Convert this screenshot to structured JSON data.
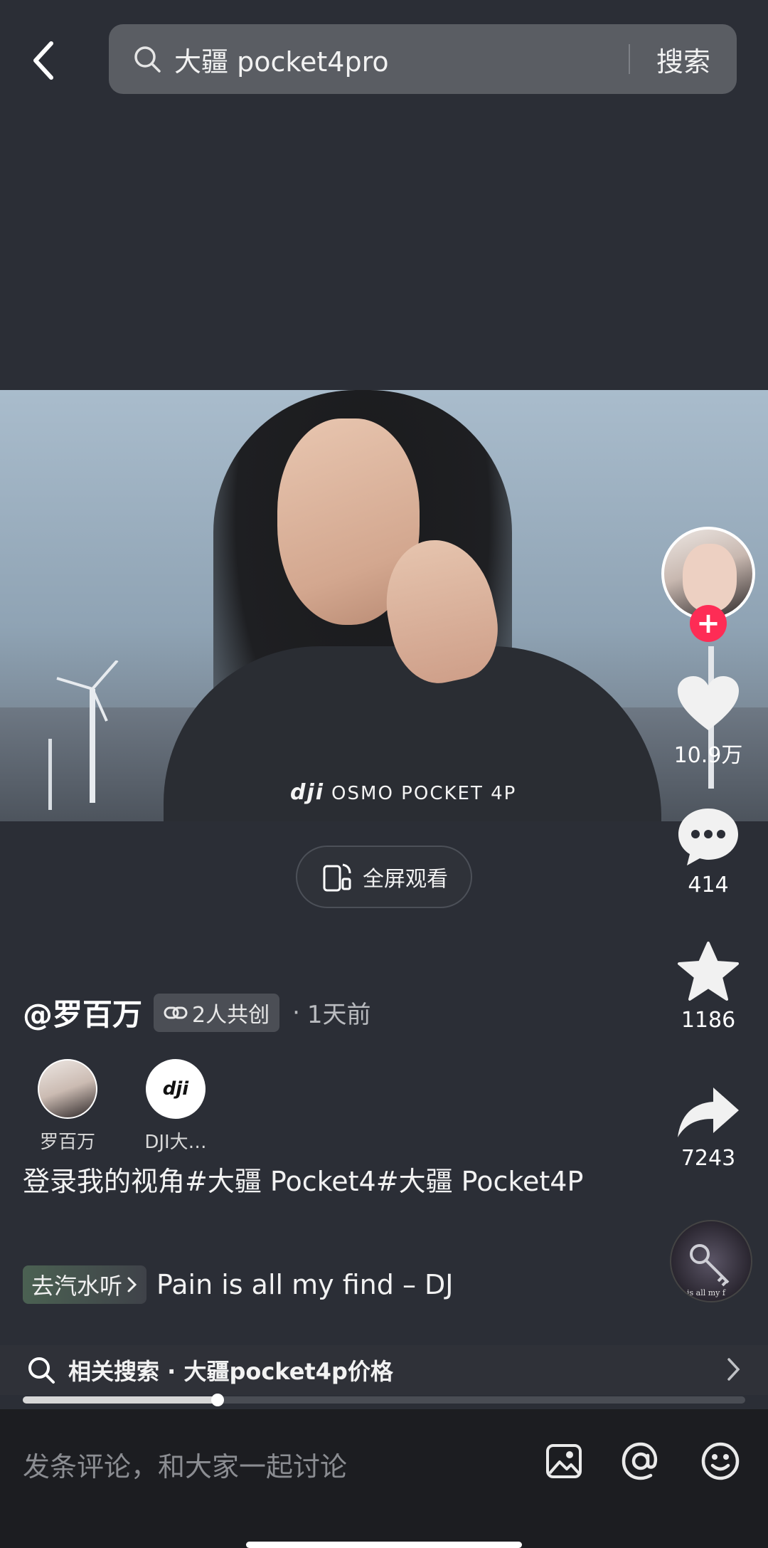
{
  "search": {
    "query": "大疆 pocket4pro",
    "submit_label": "搜索"
  },
  "video": {
    "watermark_brand": "dji",
    "watermark_model": "OSMO POCKET 4P"
  },
  "fullscreen": {
    "label": "全屏观看"
  },
  "rail": {
    "likes": "10.9万",
    "comments": "414",
    "favorites": "1186",
    "shares": "7243",
    "follow_symbol": "+"
  },
  "author": {
    "name": "@罗百万",
    "co_create": "2人共创",
    "separator": "·",
    "time_ago": "1天前"
  },
  "creators": [
    {
      "name": "罗百万"
    },
    {
      "name": "DJI大…",
      "logo_text": "dji"
    }
  ],
  "caption": "登录我的视角#大疆 Pocket4#大疆 Pocket4P",
  "music": {
    "tag": "去汽水听",
    "title": "Pain is all my find – DJ",
    "disc_text": "is all my f"
  },
  "related": {
    "text": "相关搜索 · 大疆pocket4p价格"
  },
  "progress": {
    "fraction": 0.27
  },
  "comment": {
    "placeholder": "发条评论，和大家一起讨论"
  },
  "colors": {
    "background": "#2b2e36",
    "follow": "#fe2c55",
    "comment_bar": "#1c1d21"
  }
}
